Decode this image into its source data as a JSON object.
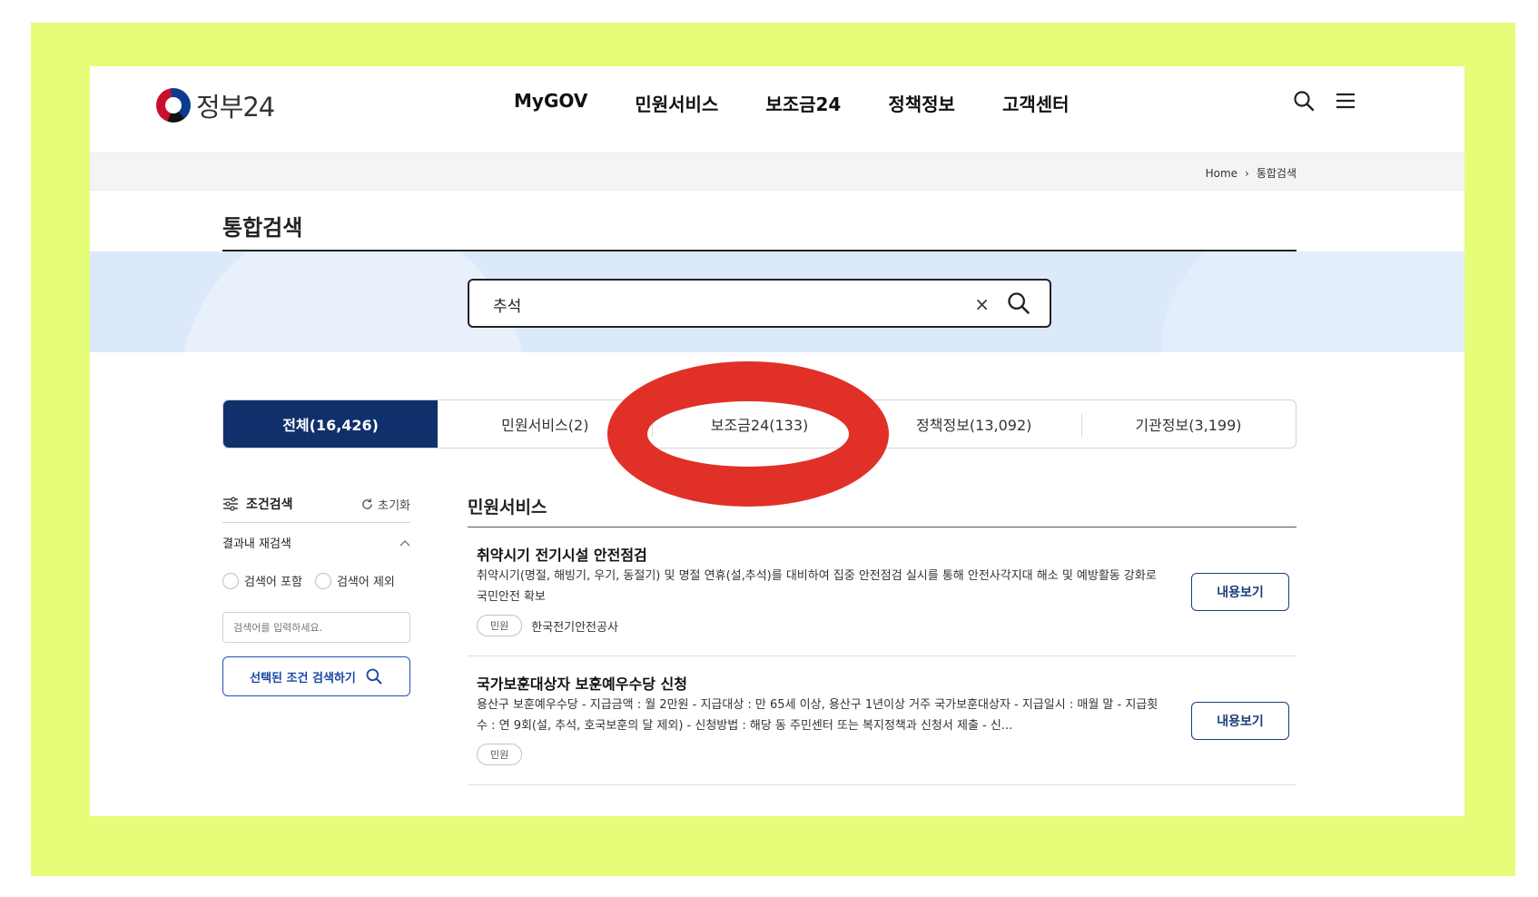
{
  "header": {
    "logo_text": "정부24",
    "nav": [
      "MyGOV",
      "민원서비스",
      "보조금24",
      "정책정보",
      "고객센터"
    ]
  },
  "breadcrumb": {
    "home": "Home",
    "current": "통합검색"
  },
  "page_title": "통합검색",
  "search": {
    "value": "추석",
    "clear": "×"
  },
  "tabs": [
    {
      "label": "전체(16,426)",
      "active": true
    },
    {
      "label": "민원서비스(2)",
      "active": false
    },
    {
      "label": "보조금24(133)",
      "active": false,
      "circled": true
    },
    {
      "label": "정책정보(13,092)",
      "active": false
    },
    {
      "label": "기관정보(3,199)",
      "active": false
    }
  ],
  "filter": {
    "title": "조건검색",
    "reset": "초기화",
    "subtitle": "결과내 재검색",
    "include": "검색어 포함",
    "exclude": "검색어 제외",
    "input_placeholder": "검색어를 입력하세요.",
    "submit": "선택된 조건 검색하기"
  },
  "results": {
    "section_title": "민원서비스",
    "items": [
      {
        "title": "취약시기 전기시설 안전점검",
        "desc": "취약시기(명절, 해빙기, 우기, 동절기) 및 명절 연휴(설,추석)를 대비하여 집중 안전점검 실시를 통해 안전사각지대 해소 및 예방활동 강화로 국민안전 확보",
        "tag": "민원",
        "org": "한국전기안전공사",
        "button": "내용보기"
      },
      {
        "title": "국가보훈대상자 보훈예우수당 신청",
        "desc": "용산구 보훈예우수당 - 지급금액 : 월 2만원 - 지급대상 : 만 65세 이상, 용산구 1년이상 거주 국가보훈대상자 - 지급일시 : 매월 말 - 지급횟수 : 연 9회(설, 추석, 호국보훈의 달 제외) - 신청방법 : 해당 동 주민센터 또는 복지정책과 신청서 제출 - 신...",
        "tag": "민원",
        "org": "",
        "button": "내용보기"
      }
    ]
  },
  "colors": {
    "frame": "#e5fd78",
    "navy": "#10306b",
    "circle": "#e0281f",
    "band": "#dce9fb"
  }
}
